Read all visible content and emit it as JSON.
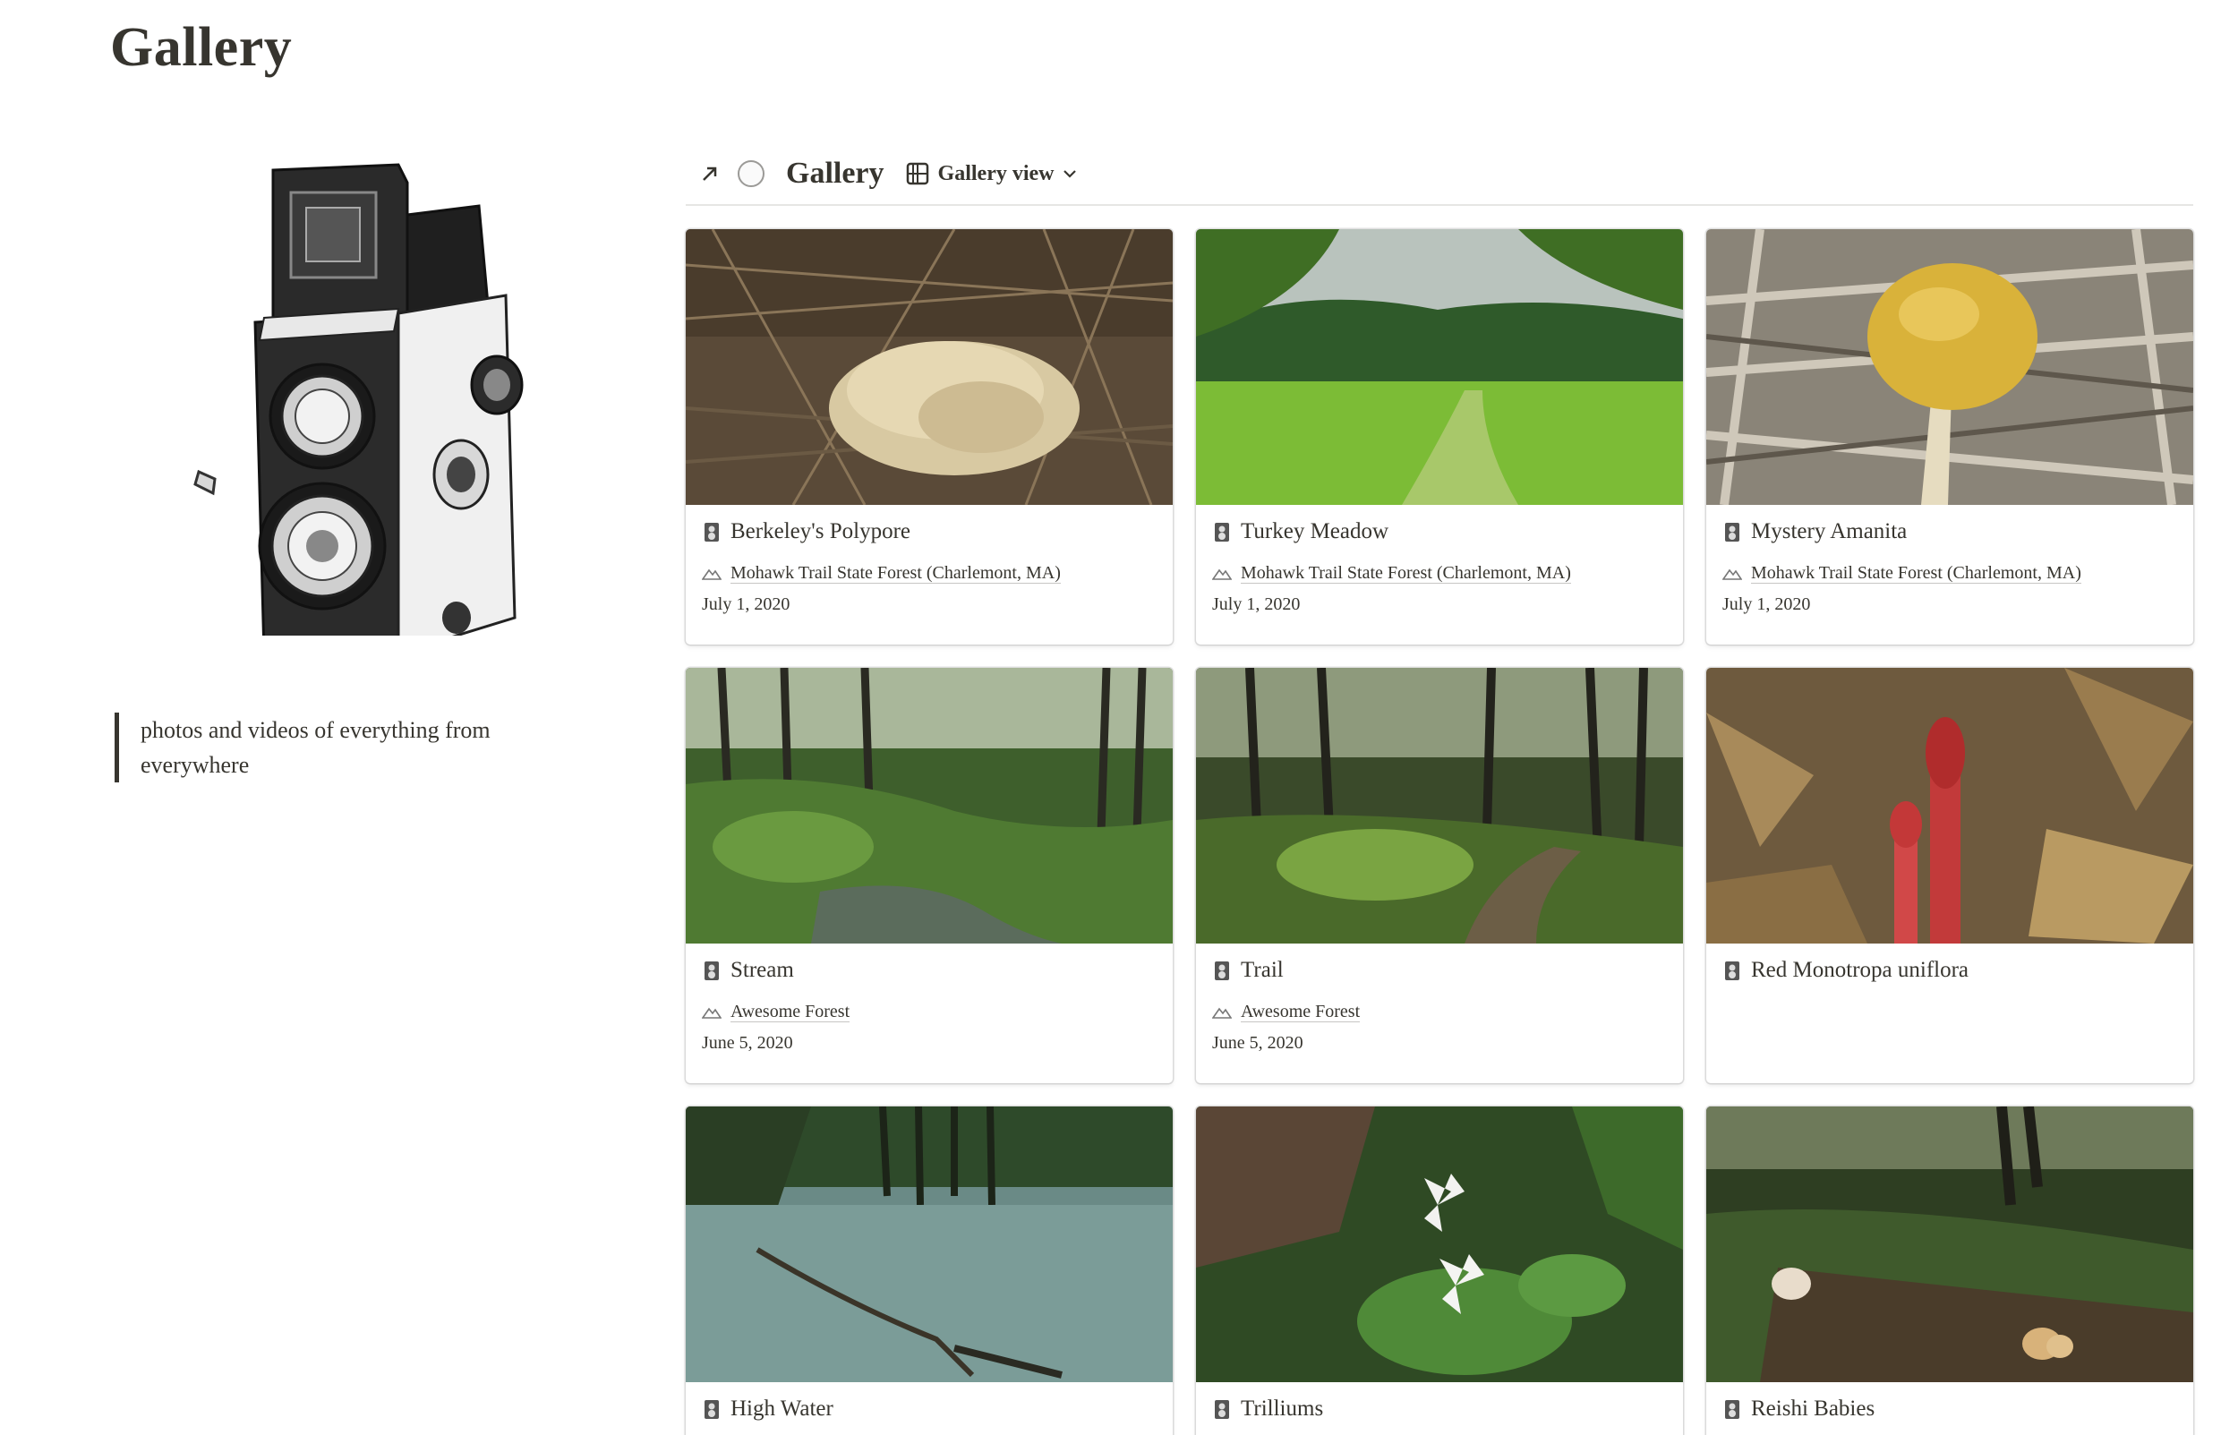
{
  "page": {
    "title": "Gallery"
  },
  "quote": {
    "text": "photos and videos of everything from everywhere"
  },
  "gallery": {
    "title": "Gallery",
    "view_label": "Gallery view",
    "icons": {
      "link": "arrow-up-right-icon",
      "page": "circle-icon",
      "view": "grid-icon",
      "dropdown": "chevron-down-icon"
    }
  },
  "cards": [
    {
      "name": "Berkeley's Polypore",
      "location": "Mohawk Trail State Forest (Charlemont, MA)",
      "date": "July 1, 2020"
    },
    {
      "name": "Turkey Meadow",
      "location": "Mohawk Trail State Forest (Charlemont, MA)",
      "date": "July 1, 2020"
    },
    {
      "name": "Mystery Amanita",
      "location": "Mohawk Trail State Forest (Charlemont, MA)",
      "date": "July 1, 2020"
    },
    {
      "name": "Stream",
      "location": "Awesome Forest",
      "date": "June 5, 2020"
    },
    {
      "name": "Trail",
      "location": "Awesome Forest",
      "date": "June 5, 2020"
    },
    {
      "name": "Red Monotropa uniflora",
      "location": "",
      "date": ""
    },
    {
      "name": "High Water",
      "location": "",
      "date": ""
    },
    {
      "name": "Trilliums",
      "location": "",
      "date": ""
    },
    {
      "name": "Reishi Babies",
      "location": "",
      "date": ""
    }
  ],
  "colors": {
    "text": "#37352f",
    "muted": "#9b9a97",
    "divider": "#e6e6e4"
  }
}
